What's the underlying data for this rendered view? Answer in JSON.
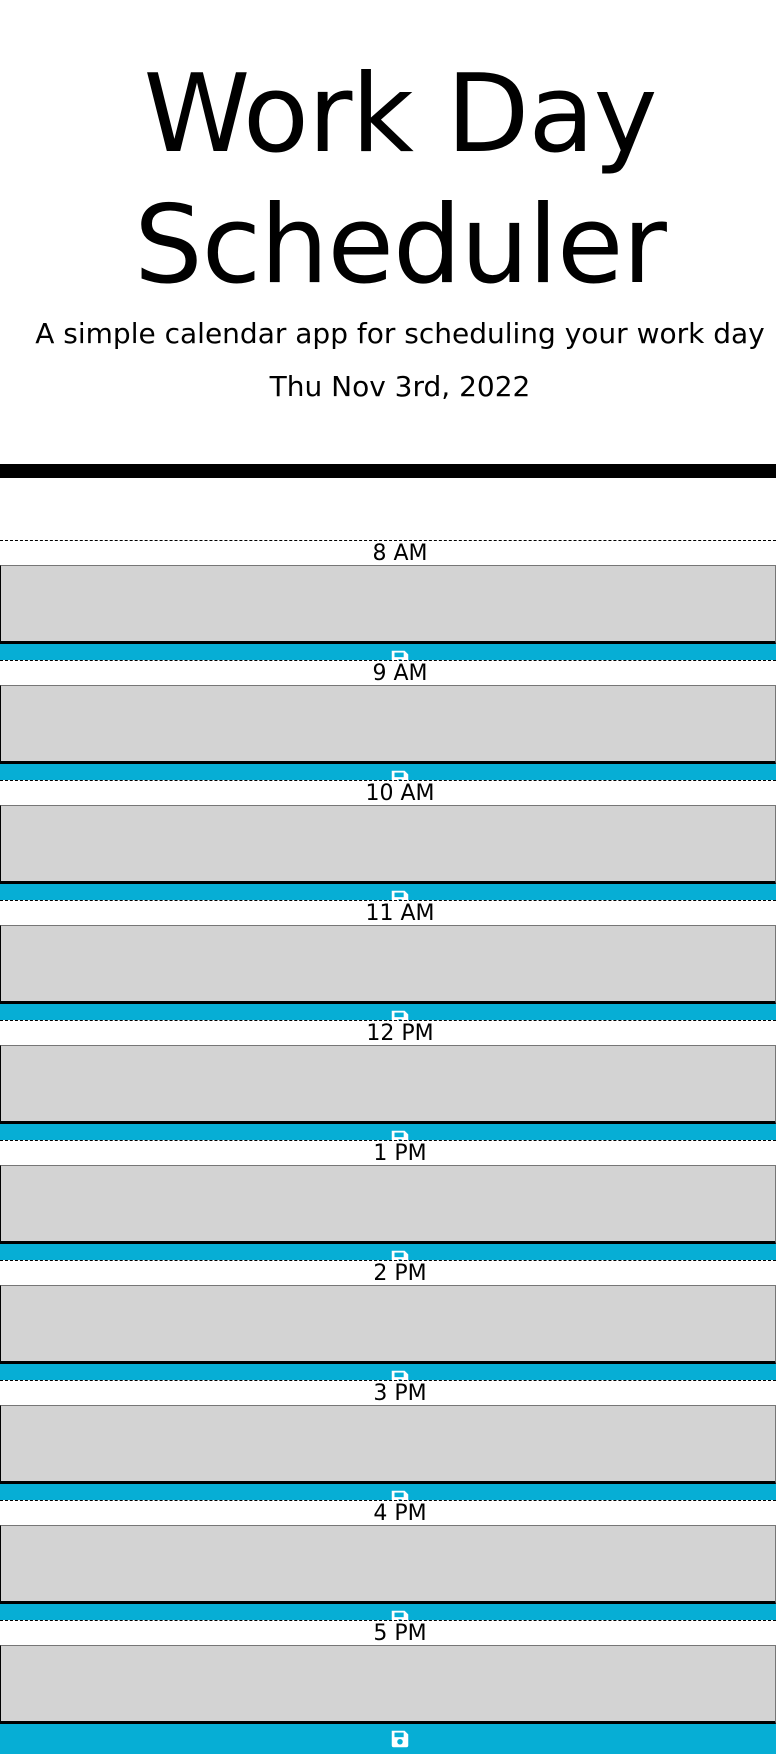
{
  "header": {
    "title_line1": "Work Day",
    "title_line2": "Scheduler",
    "lead": "A simple calendar app for scheduling your work day",
    "current_day": "Thu Nov 3rd, 2022"
  },
  "colors": {
    "save_button": "#06aed5",
    "textarea_past": "#d3d3d3",
    "header_border": "#000000"
  },
  "icons": {
    "save": "floppy-disk-icon"
  },
  "time_blocks": [
    {
      "hour": "8 AM",
      "text": ""
    },
    {
      "hour": "9 AM",
      "text": ""
    },
    {
      "hour": "10 AM",
      "text": ""
    },
    {
      "hour": "11 AM",
      "text": ""
    },
    {
      "hour": "12 PM",
      "text": ""
    },
    {
      "hour": "1 PM",
      "text": ""
    },
    {
      "hour": "2 PM",
      "text": ""
    },
    {
      "hour": "3 PM",
      "text": ""
    },
    {
      "hour": "4 PM",
      "text": ""
    },
    {
      "hour": "5 PM",
      "text": ""
    }
  ]
}
